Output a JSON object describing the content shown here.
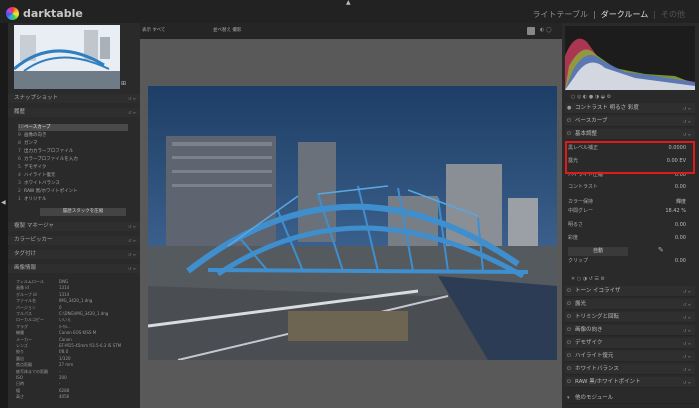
{
  "app": {
    "name": "darktable"
  },
  "views": {
    "lighttable": "ライトテーブル",
    "sep1": "|",
    "darkroom": "ダークルーム",
    "sep2": "|",
    "other": "その他"
  },
  "center_toolbar": {
    "filter": "表示 すべて",
    "sort": "並べ替え 撮影"
  },
  "left": {
    "sections": [
      {
        "label": "スナップショット"
      },
      {
        "label": "履歴"
      },
      {
        "label": "複製 マネージャ"
      },
      {
        "label": "カラーピッカー"
      },
      {
        "label": "タグ付け"
      },
      {
        "label": "画像情報"
      }
    ],
    "history": [
      {
        "n": "10",
        "label": "ベースカーブ"
      },
      {
        "n": "9",
        "label": "画像の向き"
      },
      {
        "n": "8",
        "label": "ガンマ"
      },
      {
        "n": "7",
        "label": "出力カラープロファイル"
      },
      {
        "n": "6",
        "label": "カラープロファイルを入力"
      },
      {
        "n": "5",
        "label": "デモザイク"
      },
      {
        "n": "4",
        "label": "ハイライト復元"
      },
      {
        "n": "3",
        "label": "ホワイトバランス"
      },
      {
        "n": "2",
        "label": "RAW 黒/ホワイトポイント"
      },
      {
        "n": "1",
        "label": "オリジナル"
      }
    ],
    "compress_button": "履歴スタックを圧縮",
    "image_info": [
      {
        "k": "フィルムロール",
        "v": "DNG"
      },
      {
        "k": "画像 id",
        "v": "1314"
      },
      {
        "k": "グループ id",
        "v": "1314"
      },
      {
        "k": "ファイル名",
        "v": "IMG_3420_1.dng"
      },
      {
        "k": "バージョン",
        "v": "0"
      },
      {
        "k": "フルパス",
        "v": "C:\\DNG\\IMG_3420_1.dng"
      },
      {
        "k": "ローカルコピー",
        "v": "いいえ"
      },
      {
        "k": "フラグ",
        "v": "ﾛｰｶﾙ..."
      },
      {
        "k": "機種",
        "v": "Canon EOS KISS M"
      },
      {
        "k": "メーカー",
        "v": "Canon"
      },
      {
        "k": "レンズ",
        "v": "EF-M15-45mm f/3.5-6.3 IS STM"
      },
      {
        "k": "絞り",
        "v": "f/8.0"
      },
      {
        "k": "露出",
        "v": "1/320"
      },
      {
        "k": "焦点距離",
        "v": "27 mm"
      },
      {
        "k": "被写体までの距離",
        "v": "-"
      },
      {
        "k": "ISO",
        "v": "200"
      },
      {
        "k": "日時",
        "v": "-"
      },
      {
        "k": "幅",
        "v": "6288"
      },
      {
        "k": "高さ",
        "v": "4056"
      }
    ]
  },
  "right": {
    "header_module": "コントラスト 明るさ 彩度",
    "modules_top": [
      {
        "label": "ベースカーブ"
      },
      {
        "label": "基本調整"
      }
    ],
    "basic_rows": [
      {
        "label": "黒レベル補正",
        "value": "0.0000"
      },
      {
        "label": "露光",
        "value": "0.00 EV"
      },
      {
        "label": "ハイライト圧縮",
        "value": "0.00"
      },
      {
        "label": "コントラスト",
        "value": "0.00"
      },
      {
        "label": "カラー保持",
        "value": "輝度"
      },
      {
        "label": "中間グレー",
        "value": "18.42 %"
      },
      {
        "label": "明るさ",
        "value": "0.00"
      },
      {
        "label": "彩度",
        "value": "0.00"
      }
    ],
    "auto_button": "自動",
    "clip_label": "クリップ",
    "clip_value": "0.00",
    "modules_bottom": [
      {
        "label": "トーン イコライザ"
      },
      {
        "label": "露光"
      },
      {
        "label": "トリミングと回転"
      },
      {
        "label": "画像の向き"
      },
      {
        "label": "デモザイク"
      },
      {
        "label": "ハイライト復元"
      },
      {
        "label": "ホワイトバランス"
      },
      {
        "label": "RAW 黒/ホワイトポイント"
      },
      {
        "label": "他のモジュール"
      }
    ]
  },
  "colors": {
    "highlight": "#e0191a",
    "sky": "#234a74",
    "bridge": "#3f8fcf"
  },
  "icons": [
    "darktable-logo-icon",
    "power-icon",
    "reset-icon",
    "preset-icon",
    "collapse-arrow-icon",
    "color-picker-icon"
  ]
}
